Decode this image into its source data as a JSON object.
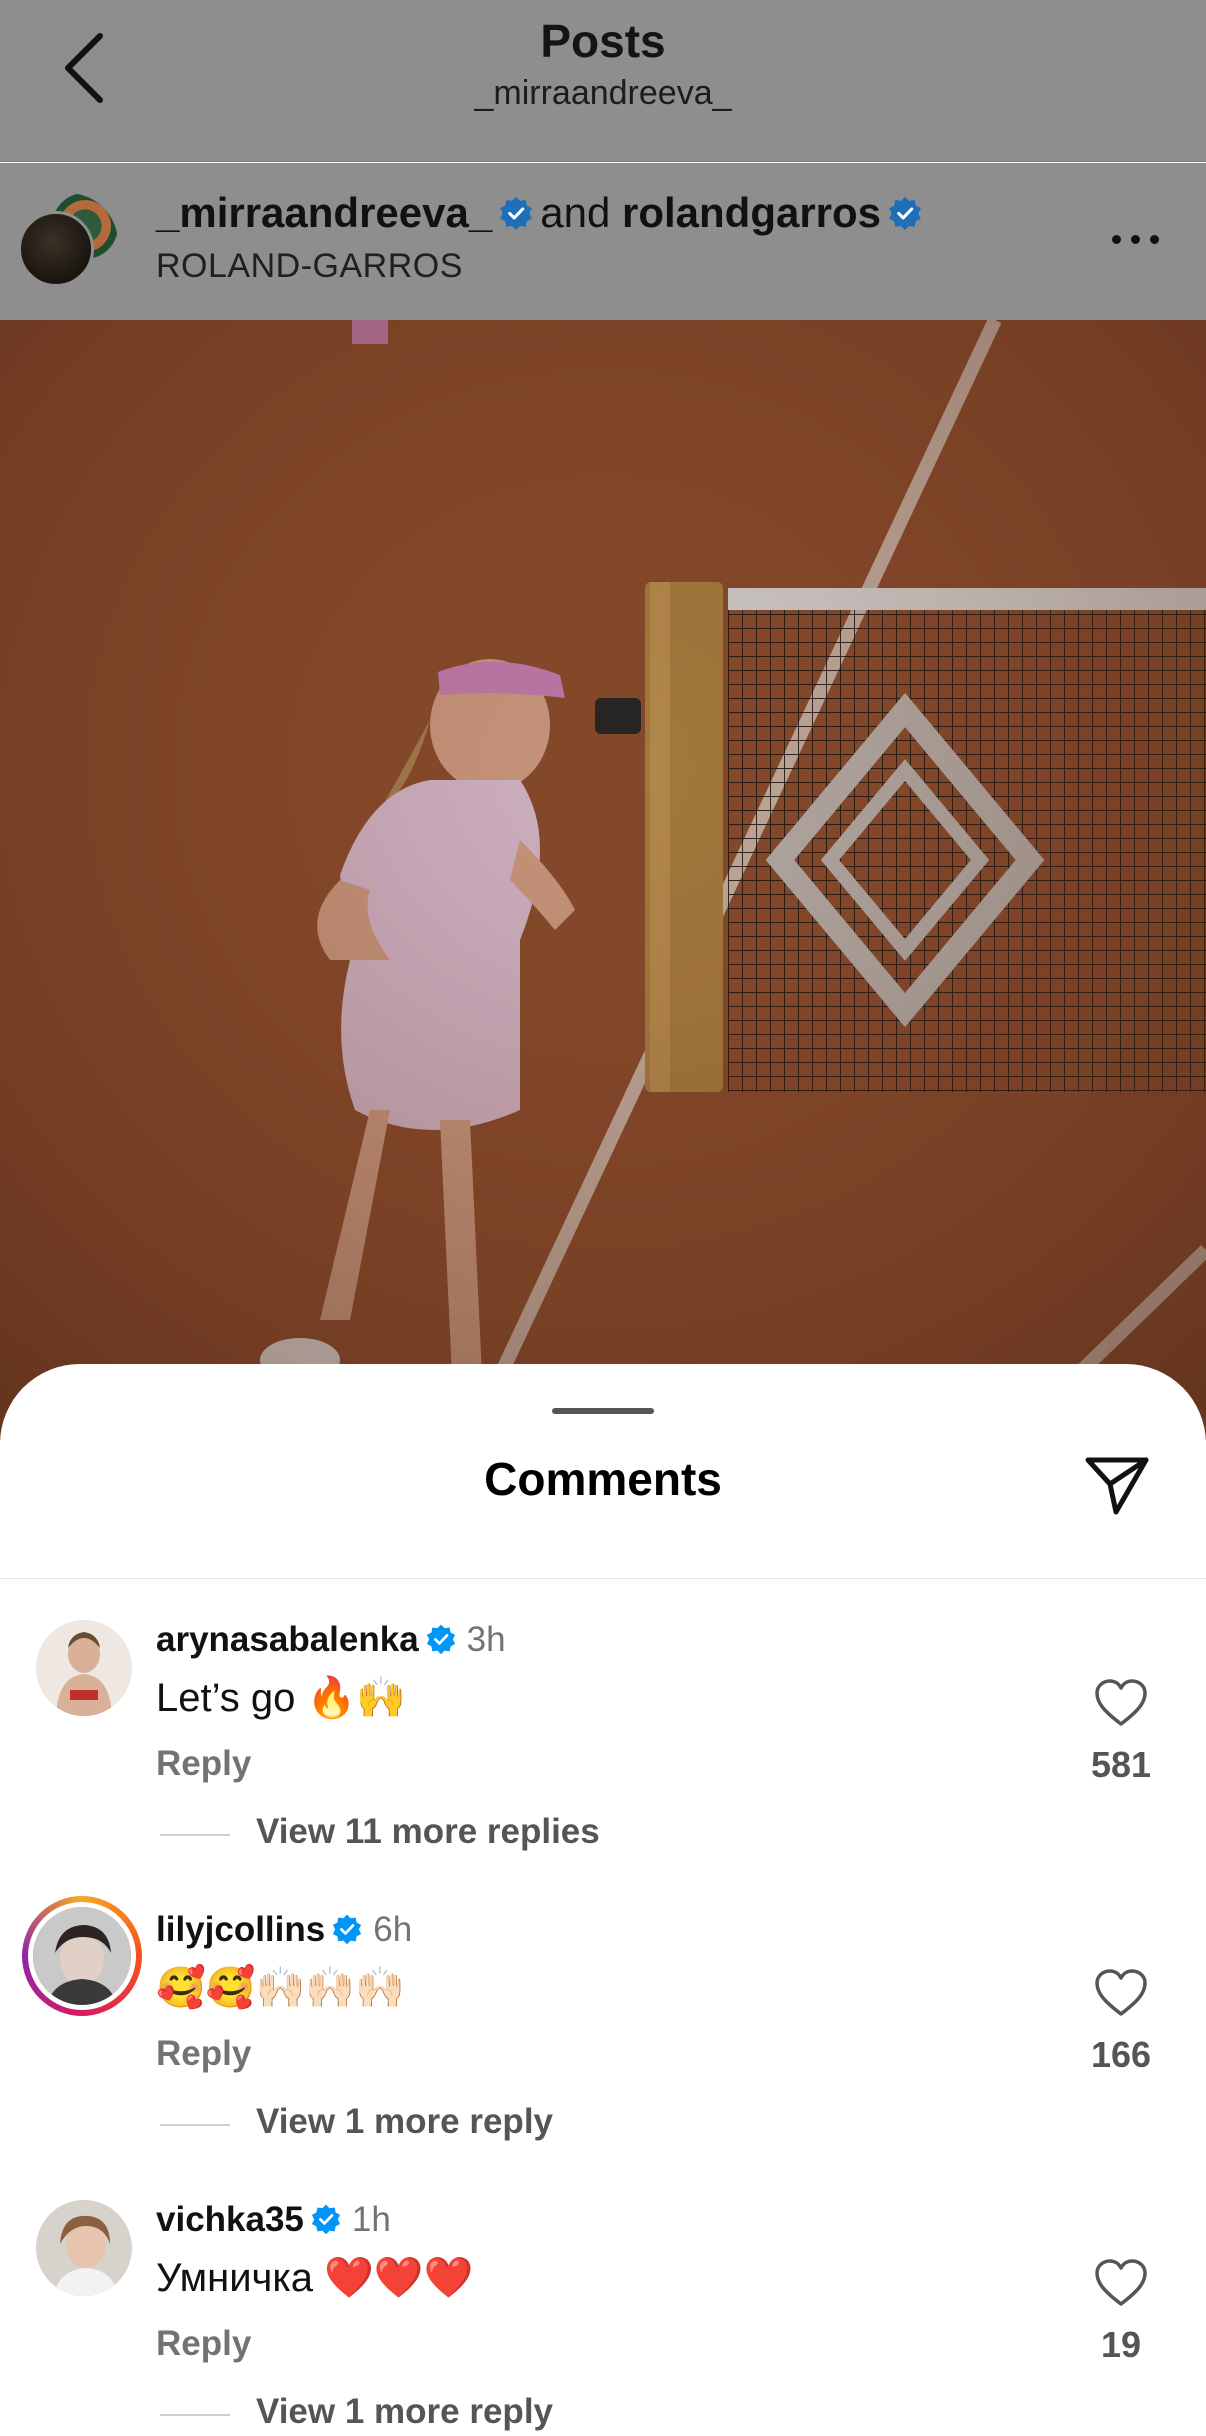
{
  "topbar": {
    "title": "Posts",
    "subtitle": "_mirraandreeva_"
  },
  "post_header": {
    "user1": "_mirraandreeva_",
    "and_text": "and",
    "user2": "rolandgarros",
    "location": "ROLAND-GARROS"
  },
  "sheet": {
    "title": "Comments"
  },
  "comments": [
    {
      "username": "arynasabalenka",
      "time": "3h",
      "text": "Let’s go 🔥🙌",
      "reply": "Reply",
      "likes": "581",
      "more": "View 11 more replies"
    },
    {
      "username": "lilyjcollins",
      "time": "6h",
      "text": "🥰🥰🙌🏻🙌🏻🙌🏻",
      "reply": "Reply",
      "likes": "166",
      "more": "View 1 more reply"
    },
    {
      "username": "vichka35",
      "time": "1h",
      "text": "Умничка ❤️❤️❤️",
      "reply": "Reply",
      "likes": "19",
      "more": "View 1 more reply"
    }
  ],
  "colors": {
    "verified": "#0095f6",
    "dim_overlay": "#8e8e8e",
    "muted_text": "#737373",
    "clay": "#9b5535"
  }
}
